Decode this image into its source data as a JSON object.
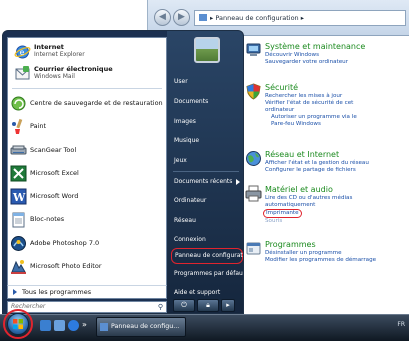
{
  "control_panel": {
    "breadcrumb": "Panneau de configuration",
    "categories": [
      {
        "title": "Système et maintenance",
        "links": [
          "Découvrir Windows",
          "Sauvegarder votre ordinateur"
        ]
      },
      {
        "title": "Sécurité",
        "links": [
          "Rechercher les mises à jour",
          "Vérifier l'état de sécurité de cet",
          "ordinateur",
          "Autoriser un programme via le",
          "Pare-feu Windows"
        ]
      },
      {
        "title": "Réseau et Internet",
        "links": [
          "Afficher l'état et la gestion du réseau",
          "Configurer le partage de fichiers"
        ]
      },
      {
        "title": "Matériel et audio",
        "links": [
          "Lire des CD ou d'autres médias",
          "automatiquement",
          "Imprimante",
          "Souris"
        ]
      },
      {
        "title": "Programmes",
        "links": [
          "Désinstaller un programme",
          "Modifier les programmes de démarrage"
        ]
      }
    ]
  },
  "start_menu": {
    "pinned": [
      {
        "title": "Internet",
        "subtitle": "Internet Explorer"
      },
      {
        "title": "Courrier électronique",
        "subtitle": "Windows Mail"
      }
    ],
    "recent": [
      "Centre de sauvegarde et de restauration",
      "Paint",
      "ScanGear Tool",
      "Microsoft Excel",
      "Microsoft Word",
      "Bloc-notes",
      "Adobe Photoshop 7.0",
      "Microsoft Photo Editor"
    ],
    "all_programs": "Tous les programmes",
    "search_placeholder": "Rechercher",
    "right": {
      "user": "User",
      "documents": "Documents",
      "images": "Images",
      "music": "Musique",
      "games": "Jeux",
      "recent_docs": "Documents récents",
      "computer": "Ordinateur",
      "network": "Réseau",
      "connect": "Connexion",
      "control_panel": "Panneau de configuration",
      "default_programs": "Programmes par défaut",
      "help": "Aide et support"
    }
  },
  "taskbar": {
    "task_label": "Panneau de configu...",
    "tray_text": "FR"
  },
  "colors": {
    "highlight": "#e0242e",
    "category_title": "#1b8a1e",
    "link": "#1a4fa8",
    "start_menu_right": "#1f3654"
  }
}
